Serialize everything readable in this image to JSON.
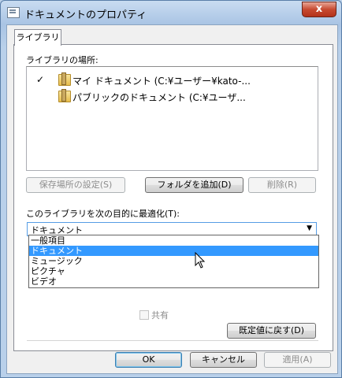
{
  "window": {
    "title": "ドキュメントのプロパティ",
    "close_label": "x"
  },
  "tabs": [
    {
      "label": "ライブラリ"
    }
  ],
  "locations": {
    "label": "ライブラリの場所:",
    "items": [
      {
        "check": "✓",
        "text": "マイ ドキュメント (C:¥ユーザー¥kato-..."
      },
      {
        "check": "",
        "text": "パブリックのドキュメント (C:¥ユーザ..."
      }
    ]
  },
  "location_buttons": {
    "set_save": "保存場所の設定(S)",
    "add_folder": "フォルダを追加(D)",
    "remove": "削除(R)"
  },
  "optimize": {
    "label": "このライブラリを次の目的に最適化(T):",
    "selected": "ドキュメント",
    "options": [
      "一般項目",
      "ドキュメント",
      "ミュージック",
      "ピクチャ",
      "ビデオ"
    ]
  },
  "attributes": {
    "shared_label": "共有"
  },
  "restore_button": "既定値に戻す(D)",
  "dialog_buttons": {
    "ok": "OK",
    "cancel": "キャンセル",
    "apply": "適用(A)"
  }
}
